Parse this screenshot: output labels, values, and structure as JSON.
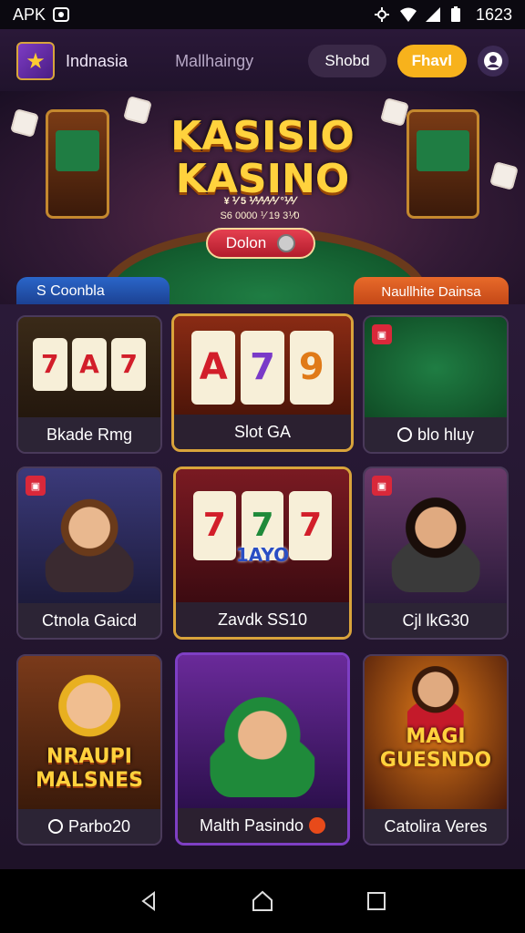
{
  "status_bar": {
    "left_label": "APK",
    "time": "1623"
  },
  "top_nav": {
    "region": "Indnasia",
    "menu_item": "Mallhaingy",
    "button_dark": "Shobd",
    "button_yellow": "Fhavl"
  },
  "banner": {
    "title_line1": "KASISIO",
    "title_line2": "KASINO",
    "subtitle1": "¥ ⅟ 5 ⅟⅟⅟⅟⅟ °⅟⅟",
    "subtitle2": "S6 0000 ⅟ 19 3⅟0",
    "button_label": "Dolon"
  },
  "tabs": {
    "left": "S Coonbla",
    "right": "Naullhite Dainsa"
  },
  "games": [
    {
      "label": "Bkade Rmg"
    },
    {
      "label": "Slot GA"
    },
    {
      "label": "blo hluy"
    },
    {
      "label": "Ctnola Gaicd"
    },
    {
      "label": "Zavdk SS10"
    },
    {
      "label": "Cjl lkG30"
    },
    {
      "label": "Parbo20"
    },
    {
      "label": "Malth Pasindo"
    },
    {
      "label": "Catolira Veres"
    }
  ],
  "card_art_text": {
    "slot_reels_1": [
      "7",
      "A",
      "7"
    ],
    "slot_reels_2": [
      "A",
      "7",
      "9"
    ],
    "slot_reels_5": [
      "7",
      "7",
      "7"
    ],
    "slot_tag_5": "1AYO",
    "poster_7_line1": "NRAUPI",
    "poster_7_line2": "MALSNES",
    "poster_9_line1": "MAGI",
    "poster_9_line2": "GUESNDO"
  },
  "colors": {
    "background": "#1a0f24",
    "accent_yellow": "#f7b21c",
    "banner_gold": "#ffd23d",
    "tab_blue": "#2a66c9",
    "tab_orange": "#e86a2a"
  },
  "icons": [
    "wifi-icon",
    "signal-icon",
    "battery-icon",
    "back-icon",
    "home-icon",
    "recents-icon",
    "user-icon"
  ]
}
